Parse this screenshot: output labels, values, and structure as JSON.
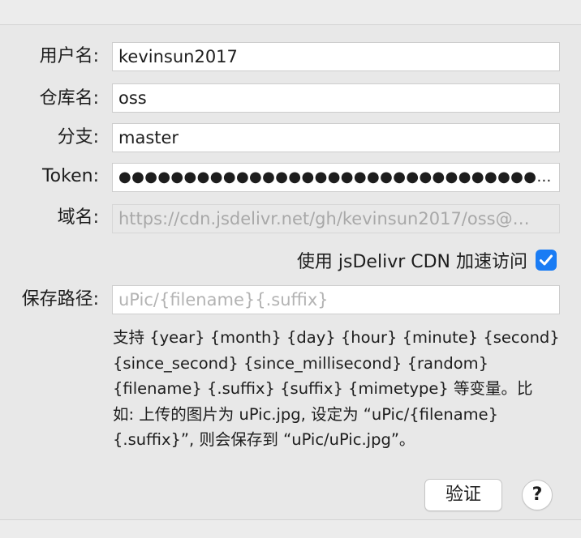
{
  "form": {
    "username": {
      "label": "用户名:",
      "value": "kevinsun2017"
    },
    "repo": {
      "label": "仓库名:",
      "value": "oss"
    },
    "branch": {
      "label": "分支:",
      "value": "master"
    },
    "token": {
      "label": "Token:",
      "value": "●●●●●●●●●●●●●●●●●●●●●●●●●●●●●●●●●●●…"
    },
    "domain": {
      "label": "域名:",
      "value": "https://cdn.jsdelivr.net/gh/kevinsun2017/oss@…"
    },
    "jsdelivr": {
      "label": "使用 jsDelivr CDN 加速访问",
      "checked": true
    },
    "save_path": {
      "label": "保存路径:",
      "placeholder": "uPic/{filename}{.suffix}"
    }
  },
  "help_lines": [
    "支持 {year} {month} {day} {hour} {minute} {second}",
    "{since_second} {since_millisecond} {random}",
    "{filename} {.suffix} {suffix} {mimetype} 等变量。比",
    "如: 上传的图片为 uPic.jpg, 设定为 “uPic/{filename}",
    "{.suffix}”, 则会保存到 “uPic/uPic.jpg”。"
  ],
  "buttons": {
    "verify": "验证",
    "help": "?"
  },
  "colors": {
    "accent": "#1a7cf4",
    "panel": "#e8e8e8"
  }
}
